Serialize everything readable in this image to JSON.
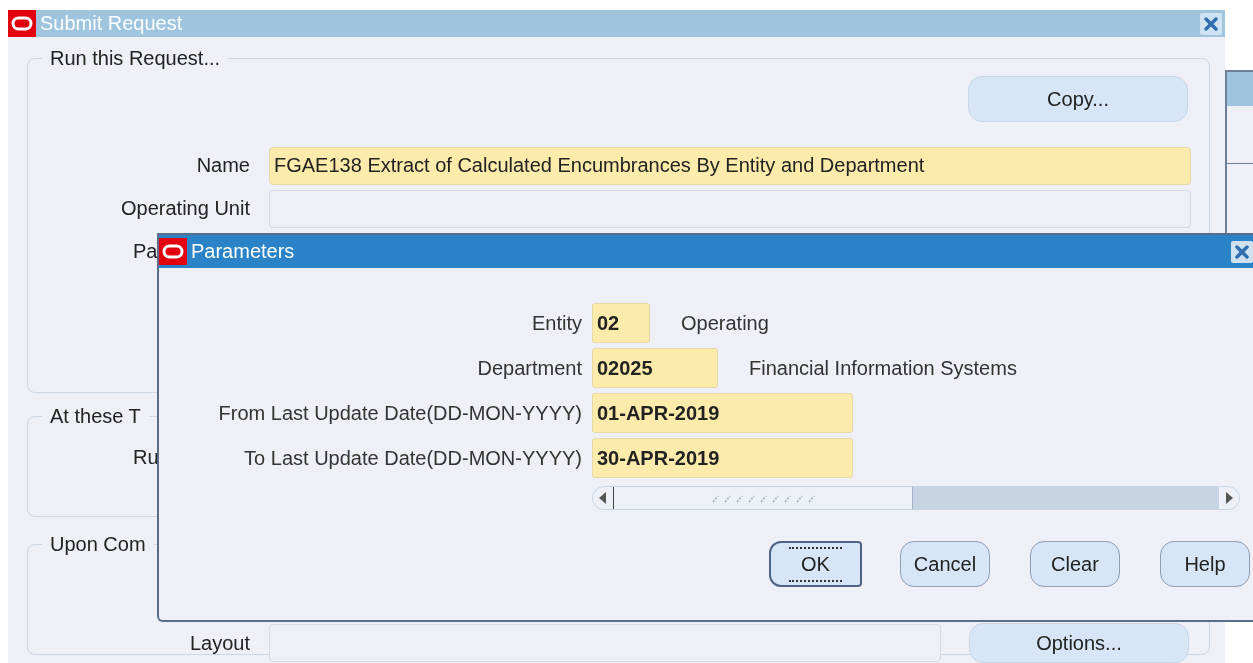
{
  "window": {
    "title": "Submit Request"
  },
  "run_request": {
    "heading": "Run this Request...",
    "copy_button": "Copy...",
    "fields": [
      {
        "label": "Name",
        "value": "FGAE138 Extract of Calculated Encumbrances By Entity and Department",
        "required": true
      },
      {
        "label": "Operating Unit",
        "required": false
      },
      {
        "label": "Pa",
        "clipped": true
      }
    ]
  },
  "schedule": {
    "heading": "At these T",
    "fields": [
      {
        "label": "Ru",
        "clipped": true
      }
    ]
  },
  "completion": {
    "heading": "Upon Com",
    "fields": [
      {
        "label": "Layout"
      }
    ],
    "options_button": "Options..."
  },
  "dialog": {
    "title": "Parameters",
    "parameters": [
      {
        "label": "Entity",
        "value": "02",
        "description": "Operating"
      },
      {
        "label": "Department",
        "value": "02025",
        "description": "Financial Information Systems"
      },
      {
        "label": "From Last Update Date(DD-MON-YYYY)",
        "value": "01-APR-2019"
      },
      {
        "label": "To Last Update Date(DD-MON-YYYY)",
        "value": "30-APR-2019"
      }
    ],
    "buttons": [
      {
        "label": "OK",
        "default": true
      },
      {
        "label": "Cancel",
        "default": false
      },
      {
        "label": "Clear",
        "default": false
      },
      {
        "label": "Help",
        "default": false
      }
    ]
  }
}
